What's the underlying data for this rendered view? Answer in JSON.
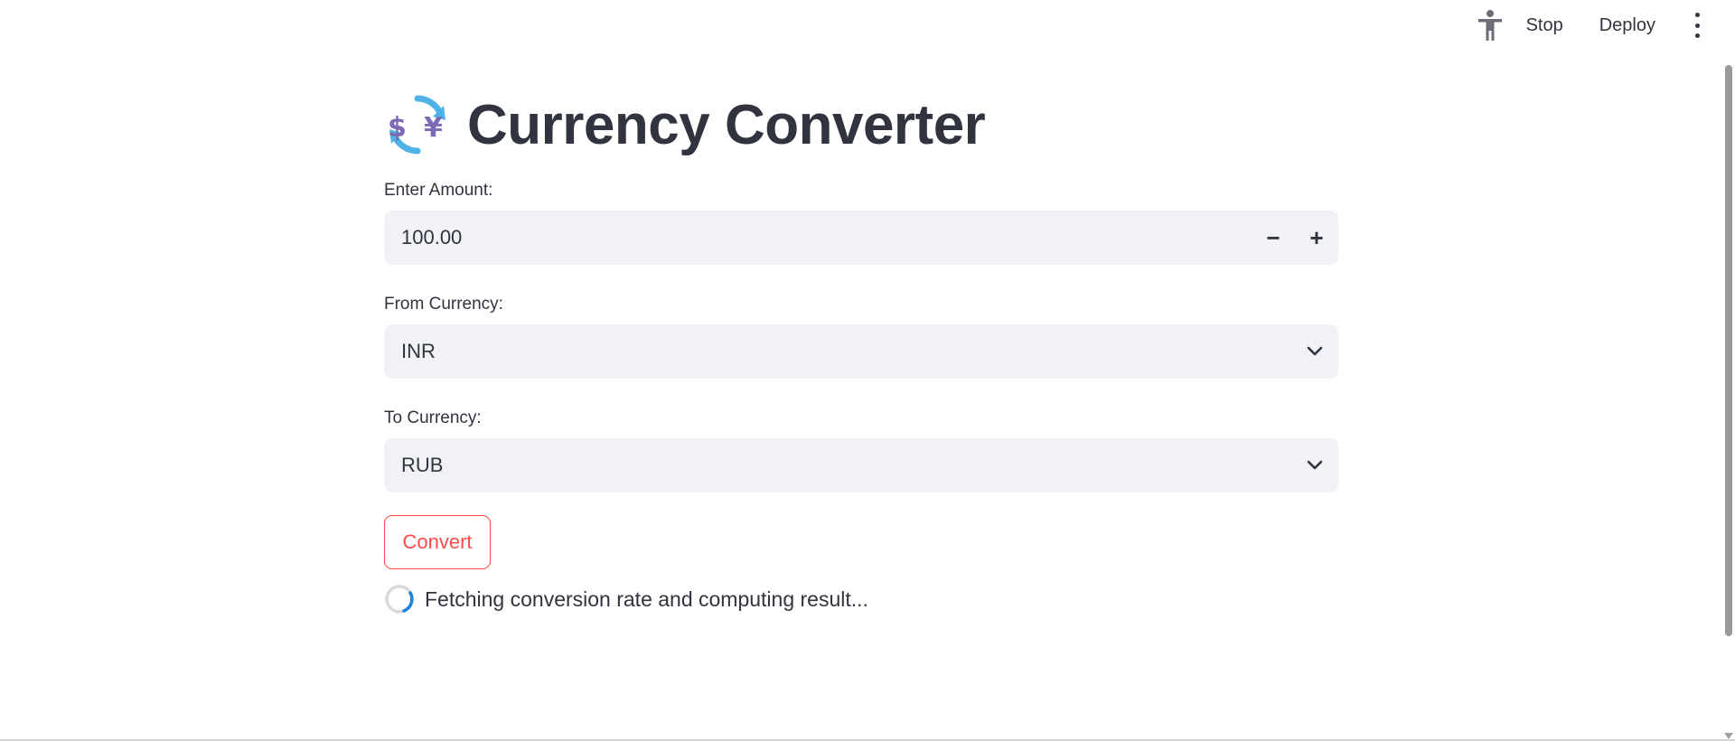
{
  "toolbar": {
    "accessibility_icon": "accessibility-person-icon",
    "stop_label": "Stop",
    "deploy_label": "Deploy",
    "menu_icon": "vertical-dots-icon"
  },
  "app": {
    "title_emoji": "currency-exchange-icon",
    "title": "Currency Converter"
  },
  "form": {
    "amount": {
      "label": "Enter Amount:",
      "value": "100.00",
      "decrement_label": "−",
      "increment_label": "+"
    },
    "from_currency": {
      "label": "From Currency:",
      "value": "INR"
    },
    "to_currency": {
      "label": "To Currency:",
      "value": "RUB"
    },
    "convert_label": "Convert"
  },
  "status": {
    "text": "Fetching conversion rate and computing result..."
  },
  "colors": {
    "primary": "#ff4b4b",
    "text": "#31333f",
    "input_bg": "#f0f2f6",
    "spinner_accent": "#1c83e1"
  }
}
